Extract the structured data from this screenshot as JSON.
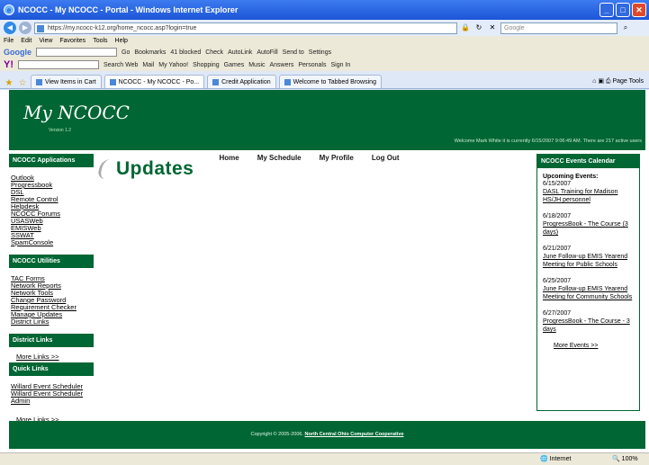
{
  "window": {
    "title": "NCOCC - My NCOCC - Portal - Windows Internet Explorer",
    "url": "https://my.ncocc-k12.org/home_ncocc.asp?login=true",
    "search_placeholder": "Google"
  },
  "menu": [
    "File",
    "Edit",
    "View",
    "Favorites",
    "Tools",
    "Help"
  ],
  "toolbar1": {
    "brand": "Google",
    "items": [
      "Go",
      "Bookmarks",
      "41 blocked",
      "Check",
      "AutoLink",
      "AutoFill",
      "Send to",
      "Settings"
    ]
  },
  "toolbar2": {
    "brand": "Y!",
    "items": [
      "Search Web",
      "Mail",
      "My Yahoo!",
      "Shopping",
      "Games",
      "Music",
      "Answers",
      "Personals",
      "Sign In"
    ]
  },
  "tabs": [
    {
      "label": "View Items in Cart"
    },
    {
      "label": "NCOCC - My NCOCC - Po..."
    },
    {
      "label": "Credit Application"
    },
    {
      "label": "Welcome to Tabbed Browsing"
    }
  ],
  "tab_tools": [
    "Page",
    "Tools"
  ],
  "page": {
    "logo": "My NCOCC",
    "version": "Version 1.2",
    "welcome": "Welcome Mark White it is currently 6/15/2007 9:06:49 AM. There are 217 active users",
    "nav": [
      "Home",
      "My Schedule",
      "My Profile",
      "Log Out"
    ],
    "title": "Updates"
  },
  "sidebar": {
    "applications": {
      "heading": "NCOCC Applications",
      "links": [
        "Outlook",
        "Progressbook",
        "DSL",
        "Remote Control",
        "Helpdesk",
        "NCOCC Forums",
        "USASWeb",
        "EMISWeb",
        "SSWAT",
        "SpamConsole"
      ]
    },
    "utilities": {
      "heading": "NCOCC Utilities",
      "links": [
        "TAC Forms",
        "Network Reports",
        "Network Tools",
        "Change Password",
        "Requirement Checker",
        "Manage Updates",
        "District Links"
      ]
    },
    "district": {
      "heading": "District Links",
      "more": "More Links >>"
    },
    "quick": {
      "heading": "Quick Links",
      "links": [
        "Willard Event Scheduler",
        "Willard Event Scheduler",
        "Admin"
      ],
      "more": "More Links >>"
    }
  },
  "calendar": {
    "heading": "NCOCC Events Calendar",
    "upcoming": "Upcoming Events:",
    "events": [
      {
        "date": "6/15/2007",
        "title": "DASL Training for Madison HS/JH personnel"
      },
      {
        "date": "6/18/2007",
        "title": "ProgressBook - The Course (3 days)"
      },
      {
        "date": "6/21/2007",
        "title": "June Follow-up EMIS Yearend Meeting for Public Schools"
      },
      {
        "date": "6/25/2007",
        "title": "June Follow-up EMIS Yearend Meeting for Community Schools"
      },
      {
        "date": "6/27/2007",
        "title": "ProgressBook - The Course - 3 days"
      }
    ],
    "more": "More Events >>"
  },
  "footer": {
    "copyright": "Copyright © 2005-2006.",
    "org": "North Central Ohio Computer Cooperative"
  },
  "status": {
    "zone": "Internet",
    "zoom": "100%"
  },
  "colors": {
    "brand_green": "#006633"
  }
}
